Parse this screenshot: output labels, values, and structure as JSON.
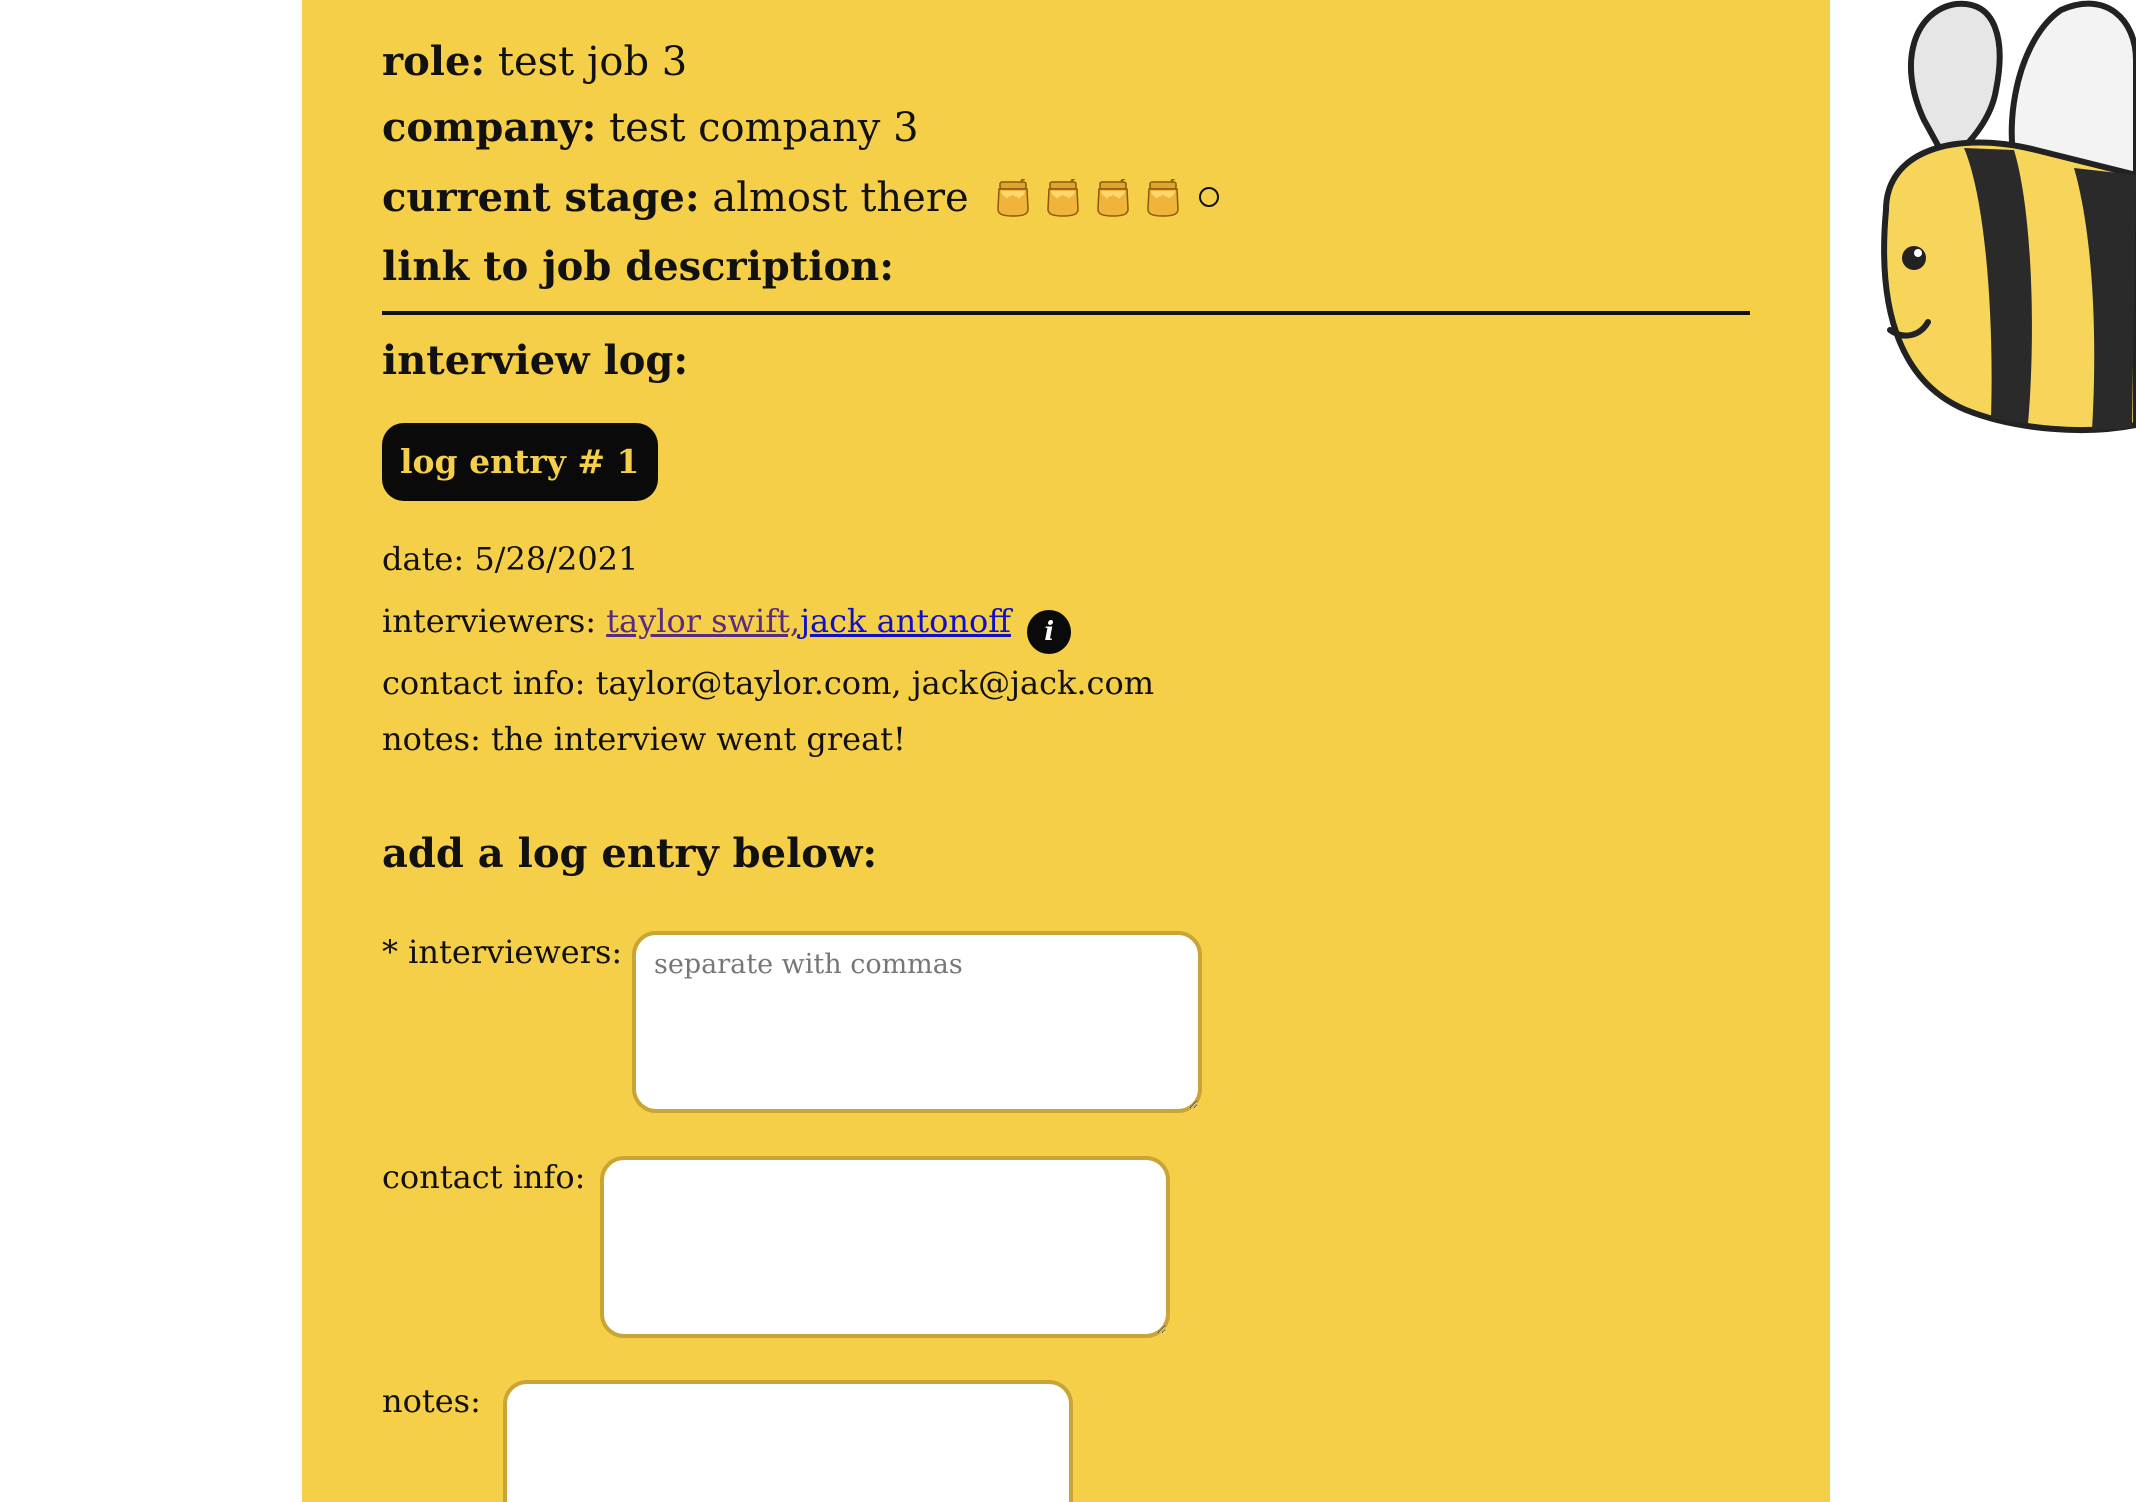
{
  "job": {
    "role_label": "role:",
    "role_value": "test job 3",
    "company_label": "company:",
    "company_value": "test company 3",
    "stage_label": "current stage:",
    "stage_value": "almost there",
    "stage_progress": {
      "filled": 4,
      "total": 5
    },
    "link_label": "link to job description:"
  },
  "log": {
    "title": "interview log:",
    "entries": [
      {
        "badge": "log entry # 1",
        "date_label": "date:",
        "date_value": "5/28/2021",
        "interviewers_label": "interviewers:",
        "interviewer_1": "taylor swift,",
        "interviewer_2": "jack antonoff",
        "info_icon": "i",
        "contact_label": "contact info:",
        "contact_value": "taylor@taylor.com, jack@jack.com",
        "notes_label": "notes:",
        "notes_value": "the interview went great!"
      }
    ]
  },
  "form": {
    "title": "add a log entry below:",
    "interviewers_label": "* interviewers:",
    "interviewers_placeholder": "separate with commas",
    "contact_label": "contact info:",
    "notes_label": "notes:"
  },
  "colors": {
    "panel": "#f6cf48",
    "badge_bg": "#0a0a0a",
    "badge_text": "#f6cf48",
    "textbox_border": "#c9a436",
    "link_visited": "#5a2c80",
    "link_unvisited": "#1010c8"
  },
  "icons": {
    "stage_filled": "honey-pot-icon",
    "stage_empty": "hollow-circle-icon",
    "info": "info-icon",
    "mascot": "bee-mascot"
  }
}
